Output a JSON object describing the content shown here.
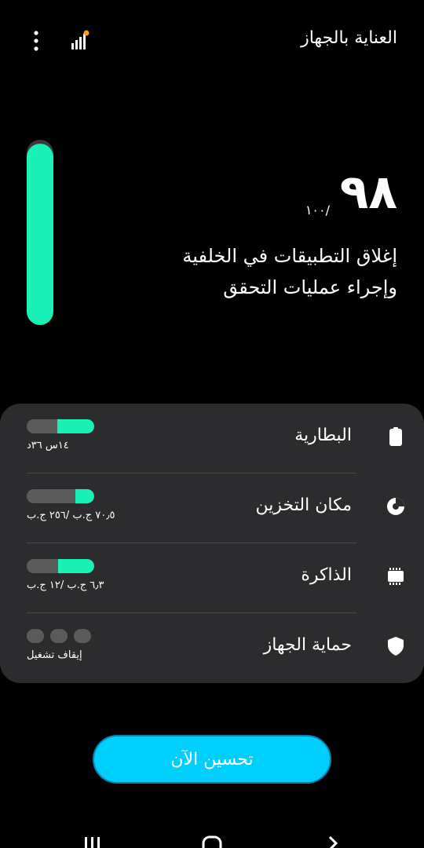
{
  "header": {
    "title": "العناية بالجهاز",
    "menu_icon": "more-vertical-icon",
    "diagnostics_icon": "signal-bars-icon",
    "notification_dot_color": "#ff9f0a"
  },
  "score": {
    "value": "٩٨",
    "max": "/١٠٠",
    "fraction": 0.98,
    "bar_color": "#19f1b6"
  },
  "message": {
    "line1": "إغلاق التطبيقات في الخلفية",
    "line2": "وإجراء عمليات التحقق"
  },
  "items": [
    {
      "label": "البطارية",
      "icon": "battery-icon",
      "value": "١٤س ٣٦د",
      "fill_fraction": 0.55
    },
    {
      "label": "مكان التخزين",
      "icon": "storage-pie-icon",
      "value": "٧٠٫٥ ج.ب /٢٥٦ ج.ب",
      "fill_fraction": 0.28
    },
    {
      "label": "الذاكرة",
      "icon": "memory-chip-icon",
      "value": "٦٫٣ ج.ب /١٢ ج.ب",
      "fill_fraction": 0.53
    },
    {
      "label": "حماية الجهاز",
      "icon": "shield-icon",
      "value": "إيقاف تشغيل"
    }
  ],
  "actions": {
    "optimize_label": "تحسين الآن"
  },
  "colors": {
    "accent": "#19f1b6",
    "button": "#00cffb",
    "card": "#2c2c2e"
  }
}
